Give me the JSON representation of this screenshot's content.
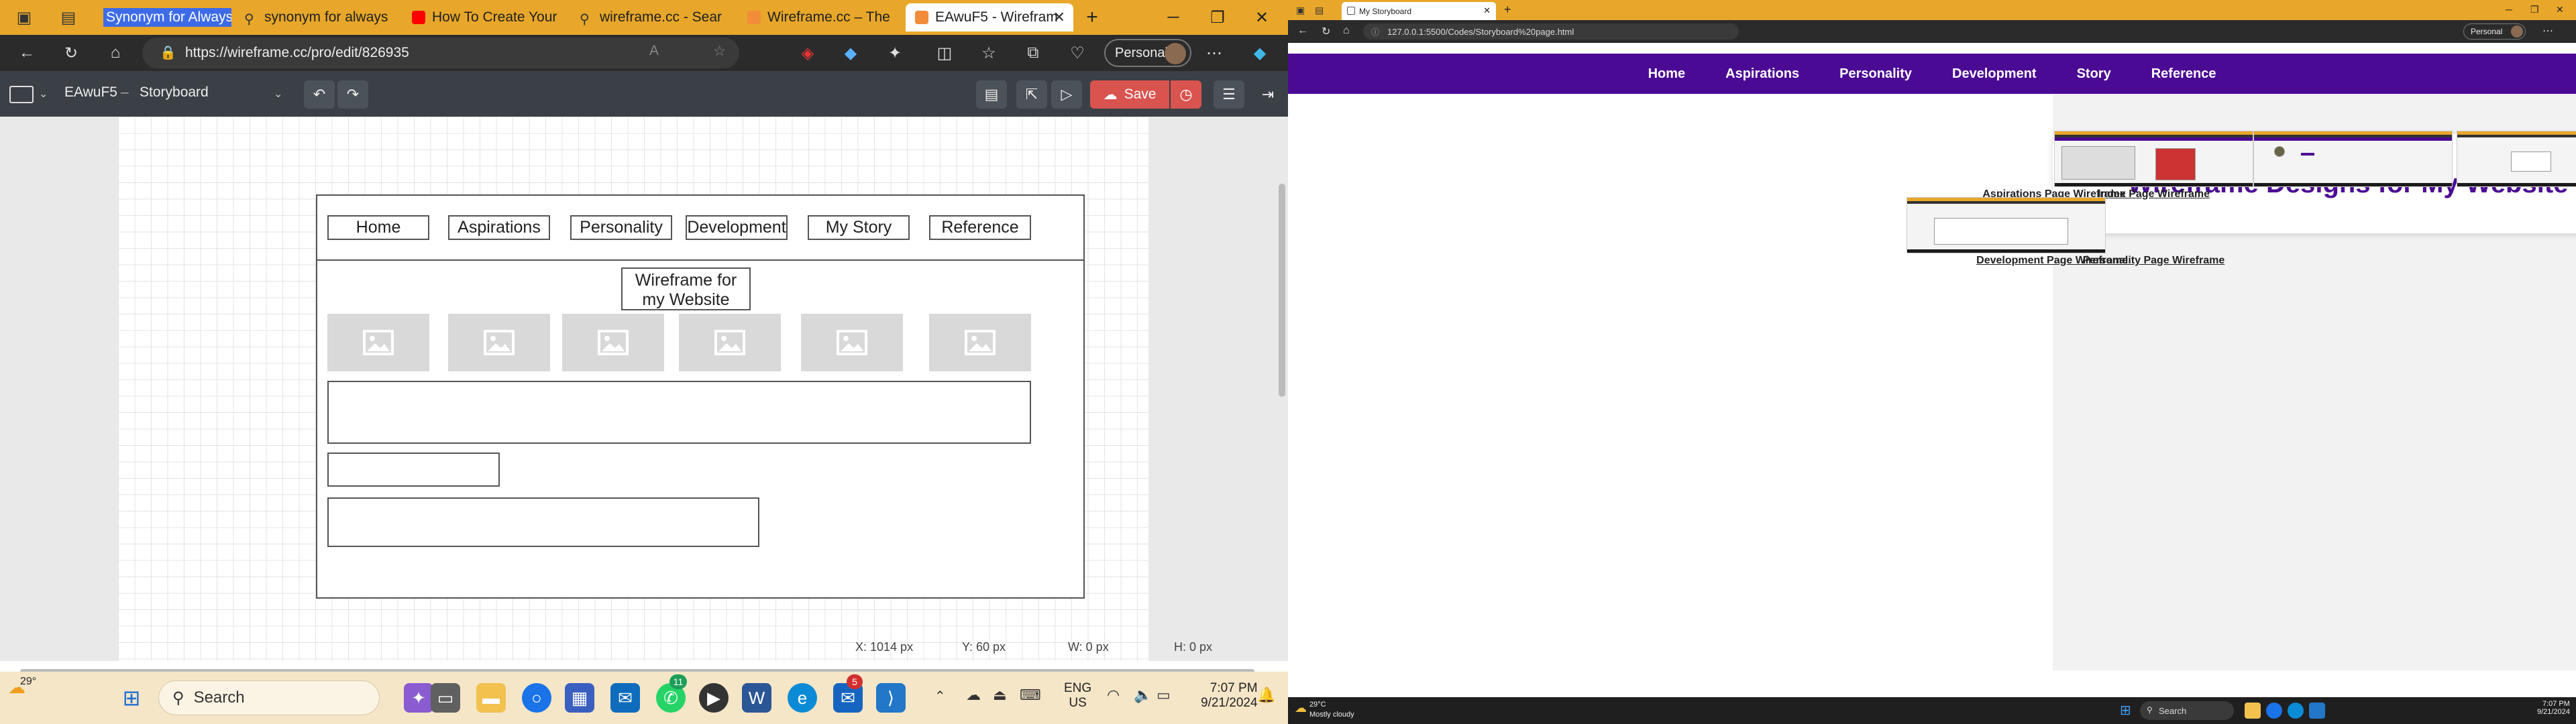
{
  "left": {
    "tabs": [
      {
        "label": "Synonym for Always",
        "color": "#3d6be8"
      },
      {
        "label": "synonym for always",
        "color": "#e1e1e1"
      },
      {
        "label": "How To Create Your",
        "color": "#ff0000"
      },
      {
        "label": "wireframe.cc - Sear",
        "color": "#e1e1e1"
      },
      {
        "label": "Wireframe.cc – The",
        "color": "#f28c38"
      },
      {
        "label": "EAwuF5 - Wirefram",
        "color": "#f28c38"
      }
    ],
    "url": "https://wireframe.cc/pro/edit/826935",
    "profile": "Personal",
    "app": {
      "doc_id": "EAwuF5",
      "separator": "–",
      "storyboard": "Storyboard",
      "save": "Save"
    },
    "wireframe": {
      "nav": [
        "Home",
        "Aspirations",
        "Personality",
        "Development",
        "My Story",
        "Reference"
      ],
      "title": "Wireframe for my Website"
    },
    "coords": {
      "x": "X: 1014 px",
      "y": "Y: 60 px",
      "w": "W: 0 px",
      "h": "H: 0 px"
    },
    "taskbar": {
      "weather_temp": "29°",
      "search": "Search",
      "lang": "ENG",
      "region": "US",
      "time": "7:07 PM",
      "date": "9/21/2024",
      "badge_whatsapp": "11",
      "badge_mail": "5"
    }
  },
  "right": {
    "tab": "My Storyboard",
    "url": "127.0.0.1:5500/Codes/Storyboard%20page.html",
    "profile": "Personal",
    "nav": [
      "Home",
      "Aspirations",
      "Personality",
      "Development",
      "Story",
      "Reference"
    ],
    "heading": "Wireframe Designs for My Website",
    "captions": [
      "Index Page Wireframe",
      "Aspirations Page Wireframe",
      "Personality Page Wireframe",
      "Development Page Wireframe"
    ],
    "taskbar": {
      "weather_temp": "29°C",
      "weather_desc": "Mostly cloudy",
      "search": "Search",
      "time": "7:07 PM",
      "date": "9/21/2024"
    }
  }
}
